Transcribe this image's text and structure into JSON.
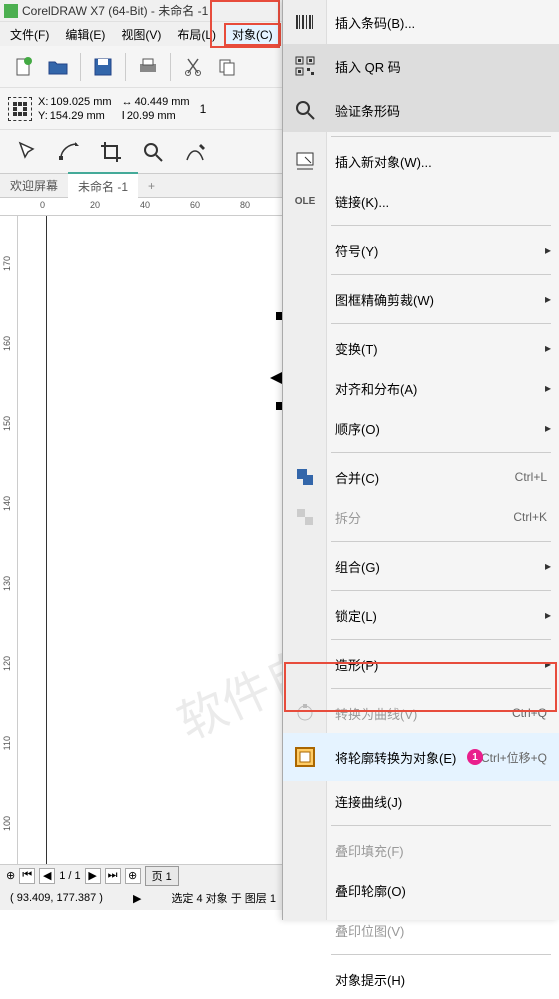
{
  "title": "CorelDRAW X7 (64-Bit) - 未命名 -1",
  "menubar": {
    "file": "文件(F)",
    "edit": "编辑(E)",
    "view": "视图(V)",
    "layout": "布局(L)",
    "object": "对象(C)"
  },
  "coords": {
    "x_label": "X:",
    "x_val": "109.025 mm",
    "y_label": "Y:",
    "y_val": "154.29 mm",
    "w_val": "40.449 mm",
    "h_val": "20.99 mm",
    "extra": "1"
  },
  "tabs": {
    "welcome": "欢迎屏幕",
    "doc": "未命名 -1"
  },
  "ruler_h": [
    "0",
    "20",
    "40",
    "60",
    "80"
  ],
  "ruler_v": [
    "170",
    "160",
    "150",
    "140",
    "130",
    "120",
    "110",
    "100"
  ],
  "pagebar": {
    "pages": "1 / 1",
    "page_label": "页 1"
  },
  "status": {
    "cursor": "( 93.409, 177.387 )",
    "selection": "选定 4 对象 于 图层 1"
  },
  "dropdown": {
    "insert_barcode": "插入条码(B)...",
    "insert_qr": "插入 QR 码",
    "verify_barcode": "验证条形码",
    "insert_new_object": "插入新对象(W)...",
    "links": "链接(K)...",
    "symbol": "符号(Y)",
    "powerclip": "图框精确剪裁(W)",
    "transform": "变换(T)",
    "align": "对齐和分布(A)",
    "order": "顺序(O)",
    "combine": "合并(C)",
    "combine_sc": "Ctrl+L",
    "break": "拆分",
    "break_sc": "Ctrl+K",
    "group": "组合(G)",
    "lock": "锁定(L)",
    "shaping": "造形(P)",
    "to_curve": "转换为曲线(V)",
    "to_curve_sc": "Ctrl+Q",
    "outline_to_obj": "将轮廓转换为对象(E)",
    "outline_sc": "Ctrl+位移+Q",
    "connect_curve": "连接曲线(J)",
    "overprint_fill": "叠印填充(F)",
    "overprint_outline": "叠印轮廓(O)",
    "overprint_bitmap": "叠印位图(V)",
    "object_hint": "对象提示(H)"
  },
  "annotation": "1",
  "watermark": "软件自学网"
}
